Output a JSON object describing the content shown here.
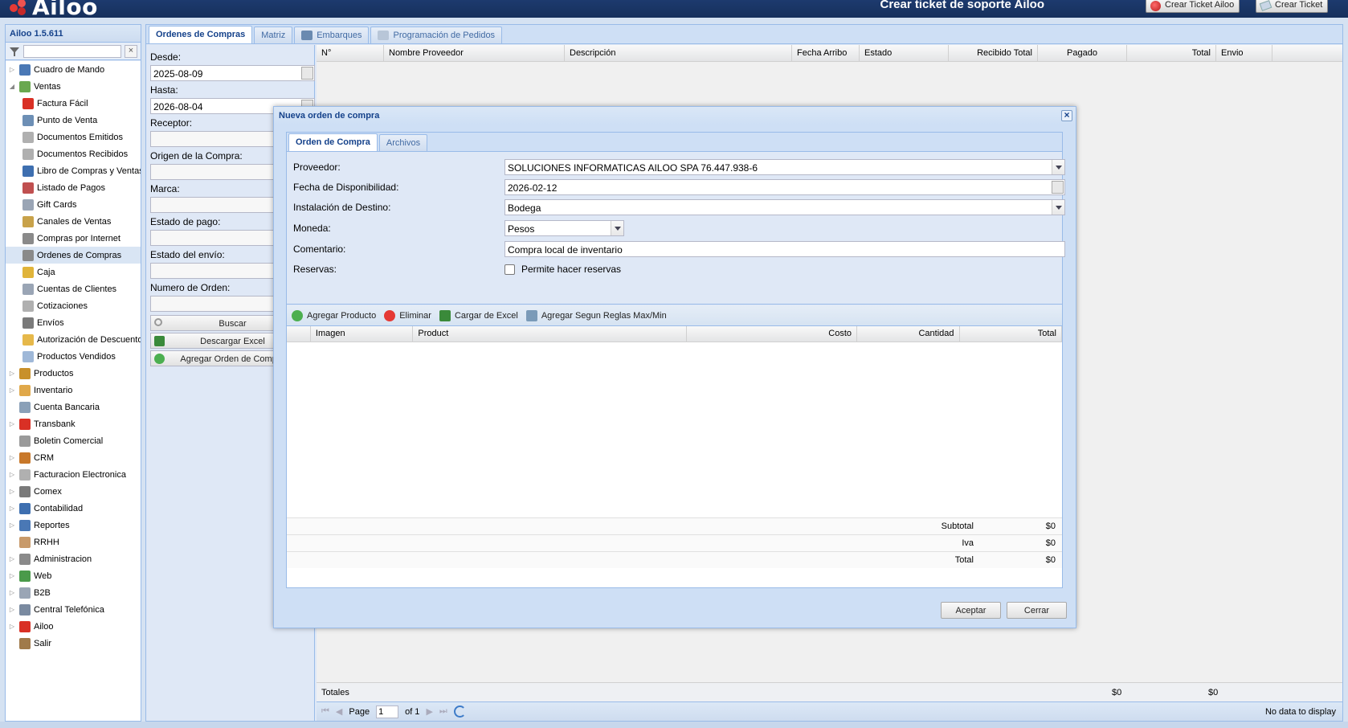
{
  "header": {
    "logo_text": "Ailoo",
    "support_text": "Crear ticket de soporte Ailoo",
    "btn_ticket_ailoo": "Crear Ticket Ailoo",
    "btn_ticket": "Crear Ticket"
  },
  "sidebar": {
    "title": "Ailoo 1.5.611",
    "filter_value": "",
    "items": [
      {
        "label": "Cuadro de Mando",
        "level": 0,
        "expandable": true,
        "icon": "dashboard-icon",
        "color": "#4a78b5"
      },
      {
        "label": "Ventas",
        "level": 0,
        "expandable": true,
        "expanded": true,
        "icon": "money-icon",
        "color": "#6aa84f"
      },
      {
        "label": "Factura Fácil",
        "level": 1,
        "icon": "ribbon-icon",
        "color": "#d93025"
      },
      {
        "label": "Punto de Venta",
        "level": 1,
        "icon": "register-icon",
        "color": "#6d8fb5"
      },
      {
        "label": "Documentos Emitidos",
        "level": 1,
        "icon": "document-icon",
        "color": "#b0b0b0"
      },
      {
        "label": "Documentos Recibidos",
        "level": 1,
        "icon": "document-icon",
        "color": "#b0b0b0"
      },
      {
        "label": "Libro de Compras y Ventas",
        "level": 1,
        "icon": "book-icon",
        "color": "#3e6fb0"
      },
      {
        "label": "Listado de Pagos",
        "level": 1,
        "icon": "list-icon",
        "color": "#c05050"
      },
      {
        "label": "Gift Cards",
        "level": 1,
        "icon": "card-icon",
        "color": "#9aa5b5"
      },
      {
        "label": "Canales de Ventas",
        "level": 1,
        "icon": "channels-icon",
        "color": "#c8a24a"
      },
      {
        "label": "Compras por Internet",
        "level": 1,
        "icon": "cart-icon",
        "color": "#8a8a8a"
      },
      {
        "label": "Ordenes de Compras",
        "level": 1,
        "icon": "cart-icon",
        "color": "#8a8a8a",
        "selected": true
      },
      {
        "label": "Caja",
        "level": 1,
        "icon": "cash-icon",
        "color": "#e0b43a"
      },
      {
        "label": "Cuentas de Clientes",
        "level": 1,
        "icon": "accounts-icon",
        "color": "#9aa5b5"
      },
      {
        "label": "Cotizaciones",
        "level": 1,
        "icon": "quote-icon",
        "color": "#b0b0b0"
      },
      {
        "label": "Envíos",
        "level": 1,
        "icon": "truck-icon",
        "color": "#7a7a7a"
      },
      {
        "label": "Autorización de Descuentos",
        "level": 1,
        "icon": "folder-icon",
        "color": "#e6b84a"
      },
      {
        "label": "Productos Vendidos",
        "level": 1,
        "icon": "table-icon",
        "color": "#9fb8d8"
      },
      {
        "label": "Productos",
        "level": 0,
        "expandable": true,
        "icon": "box-icon",
        "color": "#c8902a"
      },
      {
        "label": "Inventario",
        "level": 0,
        "expandable": true,
        "icon": "package-icon",
        "color": "#e0a84a"
      },
      {
        "label": "Cuenta Bancaria",
        "level": 0,
        "icon": "bank-icon",
        "color": "#8aa0b8"
      },
      {
        "label": "Transbank",
        "level": 0,
        "expandable": true,
        "icon": "transbank-icon",
        "color": "#d93025"
      },
      {
        "label": "Boletin Comercial",
        "level": 0,
        "icon": "tag-icon",
        "color": "#9a9a9a"
      },
      {
        "label": "CRM",
        "level": 0,
        "expandable": true,
        "icon": "crm-icon",
        "color": "#c8782a"
      },
      {
        "label": "Facturacion Electronica",
        "level": 0,
        "expandable": true,
        "icon": "invoice-icon",
        "color": "#b0b0b0"
      },
      {
        "label": "Comex",
        "level": 0,
        "expandable": true,
        "icon": "ship-icon",
        "color": "#7a7a7a"
      },
      {
        "label": "Contabilidad",
        "level": 0,
        "expandable": true,
        "icon": "calculator-icon",
        "color": "#3e6fb0"
      },
      {
        "label": "Reportes",
        "level": 0,
        "expandable": true,
        "icon": "chart-icon",
        "color": "#4a78b5"
      },
      {
        "label": "RRHH",
        "level": 0,
        "icon": "people-icon",
        "color": "#c89a6a"
      },
      {
        "label": "Administracion",
        "level": 0,
        "expandable": true,
        "icon": "gear-icon",
        "color": "#8a8a8a"
      },
      {
        "label": "Web",
        "level": 0,
        "expandable": true,
        "icon": "globe-icon",
        "color": "#4a9a4a"
      },
      {
        "label": "B2B",
        "level": 0,
        "expandable": true,
        "icon": "building-icon",
        "color": "#9aa5b5"
      },
      {
        "label": "Central Telefónica",
        "level": 0,
        "expandable": true,
        "icon": "phone-icon",
        "color": "#7a8aa0"
      },
      {
        "label": "Ailoo",
        "level": 0,
        "expandable": true,
        "icon": "ailoo-icon",
        "color": "#d93025"
      },
      {
        "label": "Salir",
        "level": 0,
        "icon": "exit-icon",
        "color": "#a07a4a"
      }
    ]
  },
  "main": {
    "tabs": [
      {
        "label": "Ordenes de Compras",
        "active": true
      },
      {
        "label": "Matriz"
      },
      {
        "label": "Embarques",
        "icon": "ship-icon"
      },
      {
        "label": "Programación de Pedidos",
        "icon": "clock-icon"
      }
    ],
    "filters": {
      "desde_label": "Desde:",
      "desde_value": "2025-08-09",
      "hasta_label": "Hasta:",
      "hasta_value": "2026-08-04",
      "receptor_label": "Receptor:",
      "origen_label": "Origen de la Compra:",
      "marca_label": "Marca:",
      "estado_pago_label": "Estado de pago:",
      "estado_envio_label": "Estado del envío:",
      "numero_orden_label": "Numero de Orden:",
      "buscar_button": "Buscar",
      "descargar_button": "Descargar Excel",
      "agregar_button": "Agregar Orden de Compra"
    },
    "grid": {
      "columns": [
        "N°",
        "Nombre Proveedor",
        "Descripción",
        "Fecha Arribo",
        "Estado",
        "Recibido Total",
        "Pagado",
        "Total",
        "Envio"
      ],
      "totals_label": "Totales",
      "totals_pagado": "$0",
      "totals_total": "$0"
    },
    "pager": {
      "page_label": "Page",
      "page_value": "1",
      "of_label": "of 1",
      "no_data": "No data to display"
    }
  },
  "modal": {
    "title": "Nueva orden de compra",
    "tabs": [
      {
        "label": "Orden de Compra",
        "active": true
      },
      {
        "label": "Archivos"
      }
    ],
    "fields": {
      "proveedor_label": "Proveedor:",
      "proveedor_value": "SOLUCIONES INFORMATICAS AILOO SPA 76.447.938-6",
      "fecha_label": "Fecha de Disponibilidad:",
      "fecha_value": "2026-02-12",
      "instalacion_label": "Instalación de Destino:",
      "instalacion_value": "Bodega",
      "moneda_label": "Moneda:",
      "moneda_value": "Pesos",
      "comentario_label": "Comentario:",
      "comentario_value": "Compra local de inventario",
      "reservas_label": "Reservas:",
      "reservas_checkbox_label": "Permite hacer reservas"
    },
    "toolbar": {
      "agregar": "Agregar Producto",
      "eliminar": "Eliminar",
      "cargar": "Cargar de Excel",
      "reglas": "Agregar Segun Reglas Max/Min"
    },
    "product_columns": [
      "Imagen",
      "Product",
      "Costo",
      "Cantidad",
      "Total"
    ],
    "summary": {
      "subtotal_label": "Subtotal",
      "subtotal_value": "$0",
      "iva_label": "Iva",
      "iva_value": "$0",
      "total_label": "Total",
      "total_value": "$0"
    },
    "aceptar_button": "Aceptar",
    "cerrar_button": "Cerrar"
  }
}
